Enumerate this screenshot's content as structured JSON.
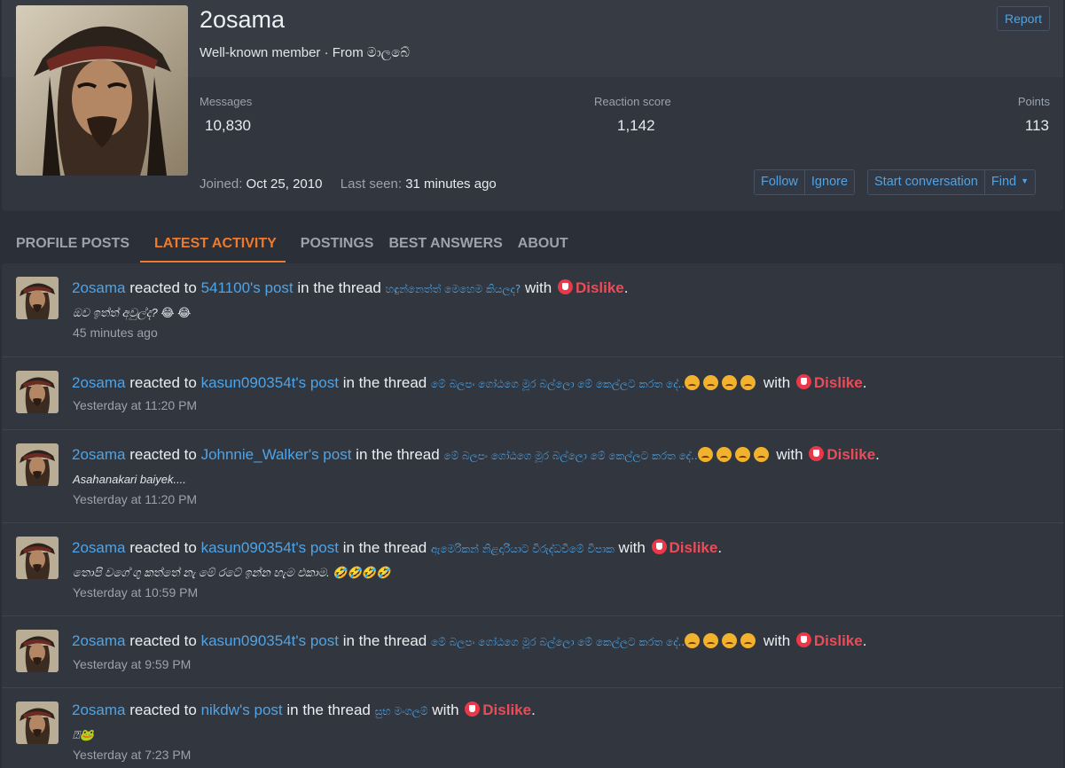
{
  "profile": {
    "username": "2osama",
    "title": "Well-known member · From මාලබේ",
    "report_label": "Report",
    "stats": {
      "messages_label": "Messages",
      "messages": "10,830",
      "reaction_label": "Reaction score",
      "reaction": "1,142",
      "points_label": "Points",
      "points": "113"
    },
    "joined_label": "Joined:",
    "joined": "Oct 25, 2010",
    "last_seen_label": "Last seen:",
    "last_seen": "31 minutes ago",
    "buttons": {
      "follow": "Follow",
      "ignore": "Ignore",
      "start_conversation": "Start conversation",
      "find": "Find"
    }
  },
  "tabs": [
    "PROFILE POSTS",
    "LATEST ACTIVITY",
    "POSTINGS",
    "BEST ANSWERS",
    "ABOUT"
  ],
  "active_tab": "LATEST ACTIVITY",
  "strings": {
    "reacted_to": "reacted to",
    "in_the_thread": "in the thread",
    "with": "with",
    "dislike": "Dislike",
    "period": "."
  },
  "activity": [
    {
      "user": "2osama",
      "post": "541100's post",
      "thread": "හඳුන්නෙත්ත් මෙහෙම කියලද?",
      "thread_emojis": [],
      "snippet": "ඔව ඉත්ත් අවුල්ද? 😂 😂",
      "time": "45 minutes ago"
    },
    {
      "user": "2osama",
      "post": "kasun090354t's post",
      "thread": "මේ බලපං ගෝඨගෙ මූර බල්ලො මේ කෙල්ලට කරත දේ..",
      "thread_emojis": [
        "angry",
        "angry",
        "angry",
        "angry"
      ],
      "snippet": "",
      "time": "Yesterday at 11:20 PM"
    },
    {
      "user": "2osama",
      "post": "Johnnie_Walker's post",
      "thread": "මේ බලපං ගෝඨගෙ මූර බල්ලො මේ කෙල්ලට කරත දේ..",
      "thread_emojis": [
        "angry",
        "angry",
        "angry",
        "angry"
      ],
      "snippet": "Asahanakari baiyek....",
      "time": "Yesterday at 11:20 PM"
    },
    {
      "user": "2osama",
      "post": "kasun090354t's post",
      "thread": "ඇමෙරිකන් නිළදාරියාට විරුද්ධවීමේ විපාක",
      "thread_emojis": [],
      "snippet": "තොපි වගේ ගු කත්තේ නැ මේ රටේ ඉන්න හැම එකාම. 🤣🤣🤣🤣",
      "time": "Yesterday at 10:59 PM"
    },
    {
      "user": "2osama",
      "post": "kasun090354t's post",
      "thread": "මේ බලපං ගෝඨගෙ මූර බල්ලො මේ කෙල්ලට කරත දේ..",
      "thread_emojis": [
        "angry",
        "angry",
        "angry",
        "angry"
      ],
      "snippet": "",
      "time": "Yesterday at 9:59 PM"
    },
    {
      "user": "2osama",
      "post": "nikdw's post",
      "thread": "සුභ මංගලම්",
      "thread_emojis": [],
      "snippet": "⍰🐸",
      "time": "Yesterday at 7:23 PM"
    }
  ]
}
